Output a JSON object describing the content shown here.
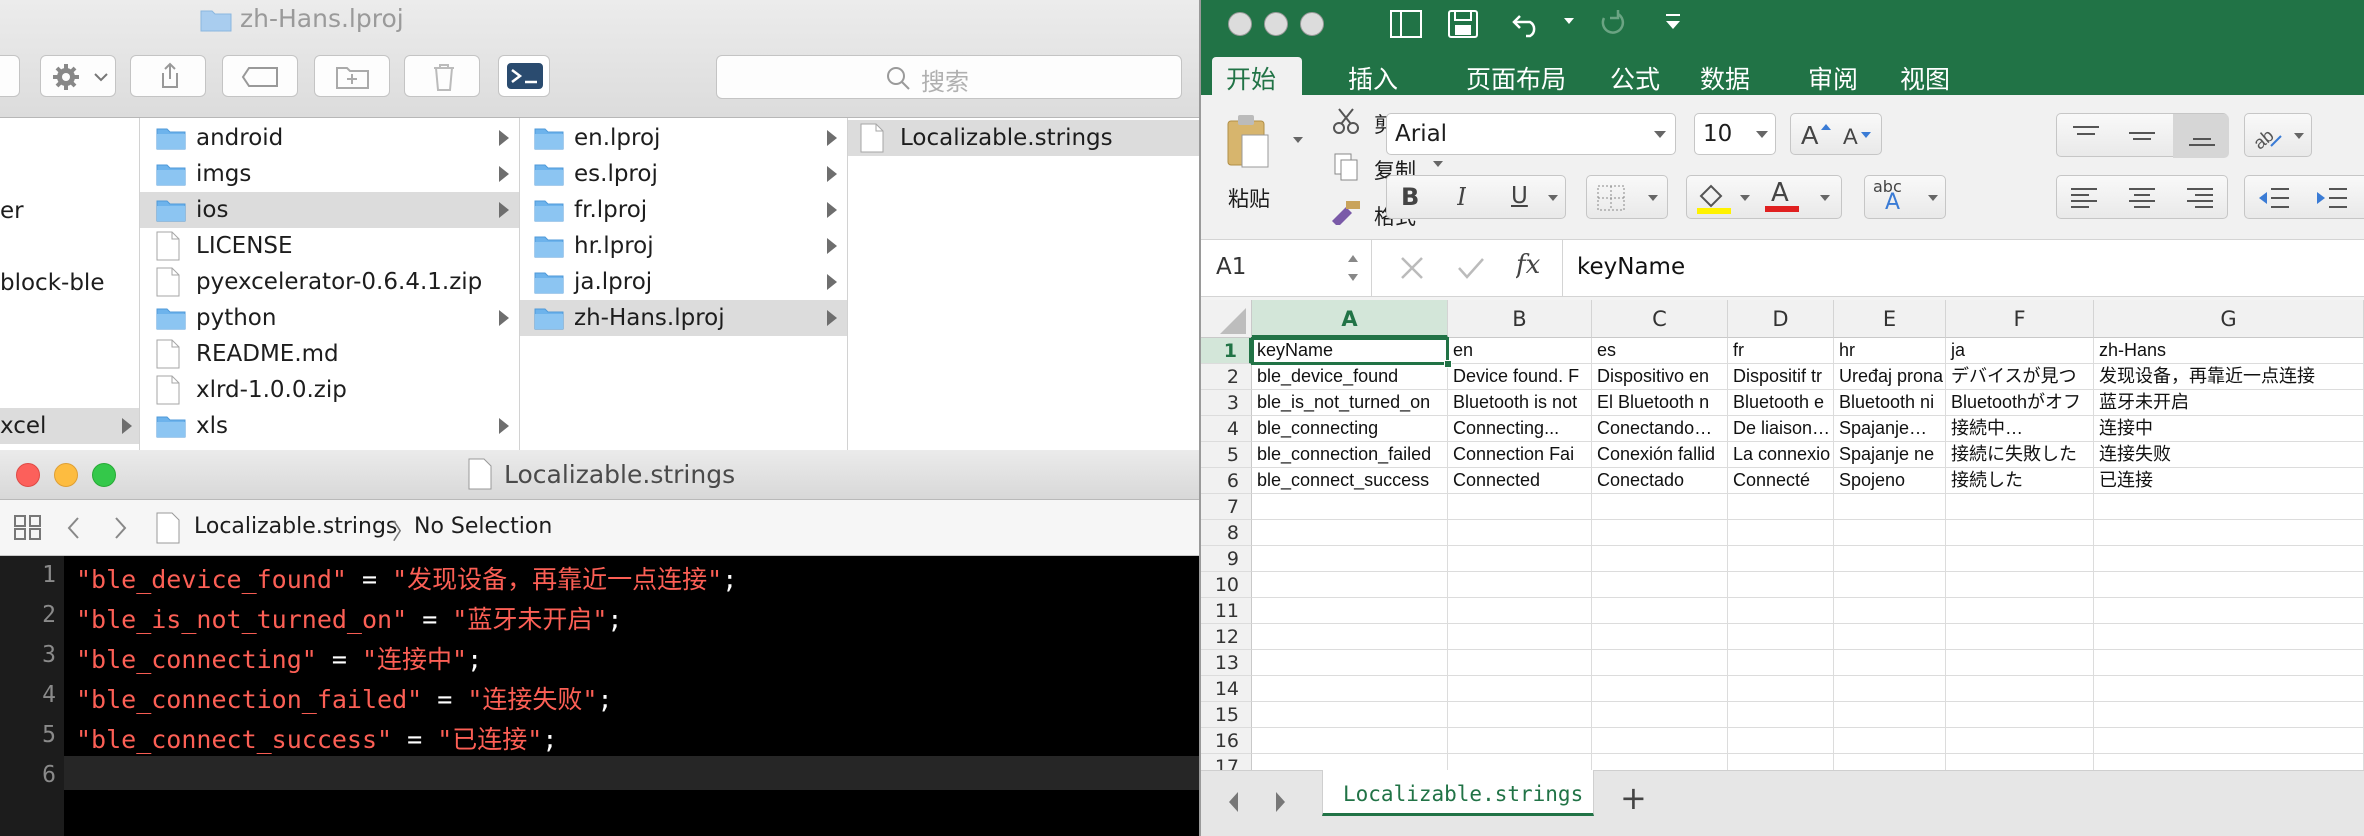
{
  "finder": {
    "title": "zh-Hans.lproj",
    "search_placeholder": "搜索",
    "col0": [
      "er",
      "block-ble",
      "xcel"
    ],
    "col1": [
      {
        "label": "android",
        "type": "folder",
        "arrow": true
      },
      {
        "label": "imgs",
        "type": "folder",
        "arrow": true
      },
      {
        "label": "ios",
        "type": "folder",
        "arrow": true
      },
      {
        "label": "LICENSE",
        "type": "file",
        "arrow": false
      },
      {
        "label": "pyexcelerator-0.6.4.1.zip",
        "type": "file",
        "arrow": false
      },
      {
        "label": "python",
        "type": "folder",
        "arrow": true
      },
      {
        "label": "README.md",
        "type": "file",
        "arrow": false
      },
      {
        "label": "xlrd-1.0.0.zip",
        "type": "file",
        "arrow": false
      },
      {
        "label": "xls",
        "type": "folder",
        "arrow": true
      }
    ],
    "col2": [
      {
        "label": "en.lproj",
        "type": "folder",
        "arrow": true
      },
      {
        "label": "es.lproj",
        "type": "folder",
        "arrow": true
      },
      {
        "label": "fr.lproj",
        "type": "folder",
        "arrow": true
      },
      {
        "label": "hr.lproj",
        "type": "folder",
        "arrow": true
      },
      {
        "label": "ja.lproj",
        "type": "folder",
        "arrow": true
      },
      {
        "label": "zh-Hans.lproj",
        "type": "folder",
        "arrow": true
      }
    ],
    "col3": [
      {
        "label": "Localizable.strings",
        "type": "file",
        "arrow": false
      }
    ]
  },
  "editor": {
    "title": "Localizable.strings",
    "breadcrumb_file": "Localizable.strings",
    "breadcrumb_sep": "〉",
    "breadcrumb_selection": "No Selection",
    "lines": [
      {
        "num": "1",
        "key": "\"ble_device_found\"",
        "eq": " = ",
        "val": "\"发现设备，再靠近一点连接\"",
        "end": ";"
      },
      {
        "num": "2",
        "key": "\"ble_is_not_turned_on\"",
        "eq": " = ",
        "val": "\"蓝牙未开启\"",
        "end": ";"
      },
      {
        "num": "3",
        "key": "\"ble_connecting\"",
        "eq": " = ",
        "val": "\"连接中\"",
        "end": ";"
      },
      {
        "num": "4",
        "key": "\"ble_connection_failed\"",
        "eq": " = ",
        "val": "\"连接失败\"",
        "end": ";"
      },
      {
        "num": "5",
        "key": "\"ble_connect_success\"",
        "eq": " = ",
        "val": "\"已连接\"",
        "end": ";"
      },
      {
        "num": "6",
        "key": "",
        "eq": "",
        "val": "",
        "end": ""
      }
    ]
  },
  "excel": {
    "tabs": [
      "开始",
      "插入",
      "页面布局",
      "公式",
      "数据",
      "审阅",
      "视图"
    ],
    "clipboard": {
      "paste": "粘贴",
      "cut": "剪切",
      "copy": "复制",
      "format": "格式"
    },
    "font_name": "Arial",
    "font_size": "10",
    "bold": "B",
    "italic": "I",
    "underline": "U",
    "font_color_letter": "A",
    "abc": "abc",
    "cell_ref": "A1",
    "fx": "fx",
    "formula_value": "keyName",
    "columns": [
      "A",
      "B",
      "C",
      "D",
      "E",
      "F",
      "G"
    ],
    "row_numbers": [
      "1",
      "2",
      "3",
      "4",
      "5",
      "6",
      "7",
      "8",
      "9",
      "10",
      "11",
      "12",
      "13",
      "14",
      "15",
      "16",
      "17"
    ],
    "cells": [
      [
        "keyName",
        "en",
        "es",
        "fr",
        "hr",
        "ja",
        "zh-Hans"
      ],
      [
        "ble_device_found",
        "Device found. F",
        "Dispositivo en",
        "Dispositif tr",
        "Uređaj prona",
        "デバイスが見つ",
        "发现设备，再靠近一点连接"
      ],
      [
        "ble_is_not_turned_on",
        "Bluetooth is not",
        "El Bluetooth n",
        "Bluetooth e",
        "Bluetooth ni",
        "Bluetoothがオフ",
        "蓝牙未开启"
      ],
      [
        "ble_connecting",
        "Connecting...",
        "Conectando…",
        "De liaison…",
        "Spajanje…",
        "接続中…",
        "连接中"
      ],
      [
        "ble_connection_failed",
        "Connection Fai",
        "Conexión fallid",
        "La connexio",
        "Spajanje ne",
        "接続に失敗した",
        "连接失败"
      ],
      [
        "ble_connect_success",
        "Connected",
        "Conectado",
        "Connecté",
        "Spojeno",
        "接続した",
        "已连接"
      ]
    ],
    "sheet_tab": "Localizable.strings",
    "add_sheet": "+"
  },
  "colors": {
    "excel_green": "#217346",
    "string_red": "#fc5f55",
    "folder_blue": "#6db3ec"
  }
}
